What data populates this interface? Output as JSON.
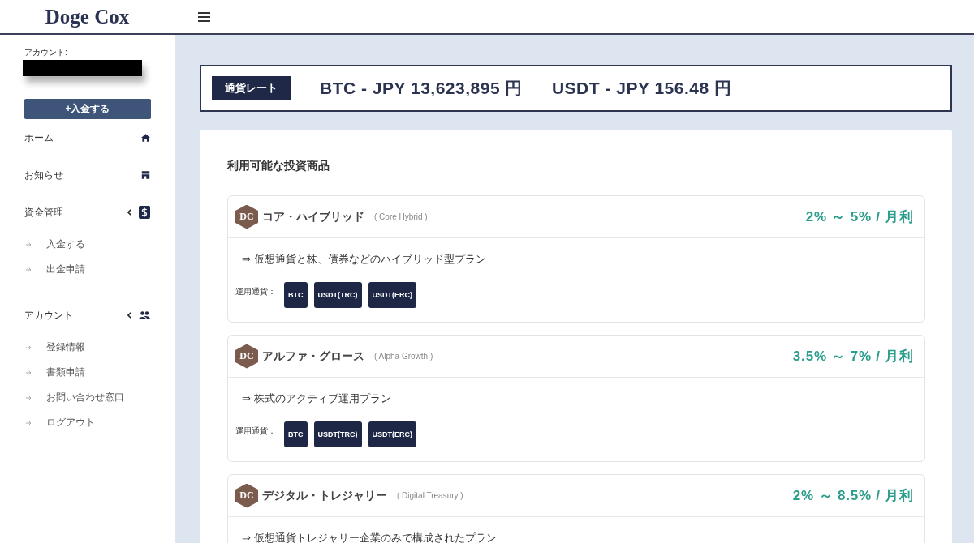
{
  "header": {
    "brand": "Doge Cox"
  },
  "sidebar": {
    "account_label": "アカウント:",
    "deposit_button": "+入金する",
    "nav": [
      {
        "kind": "link",
        "label": "ホーム"
      },
      {
        "kind": "link",
        "label": "お知らせ"
      },
      {
        "kind": "group",
        "label": "資金管理",
        "expanded": true,
        "children": [
          {
            "label": "入金する"
          },
          {
            "label": "出金申請"
          }
        ]
      },
      {
        "kind": "group",
        "label": "アカウント",
        "expanded": true,
        "children": [
          {
            "label": "登録情報"
          },
          {
            "label": "書類申請"
          },
          {
            "label": "お問い合わせ窓口"
          },
          {
            "label": "ログアウト"
          }
        ]
      }
    ]
  },
  "rates": {
    "badge": "通貨レート",
    "items": [
      "BTC - JPY 13,623,895 円",
      "USDT - JPY 156.48 円"
    ]
  },
  "products": {
    "title": "利用可能な投資商品",
    "items": [
      {
        "logo": "DC",
        "name": "コア・ハイブリッド",
        "name_en": "( Core Hybrid )",
        "rate": "2% ～ 5% / 月利",
        "description": "⇒ 仮想通貨と株、債券などのハイブリッド型プラン",
        "currency_label": "運用通貨：",
        "currencies": [
          "BTC",
          "USDT(TRC)",
          "USDT(ERC)"
        ]
      },
      {
        "logo": "DC",
        "name": "アルファ・グロース",
        "name_en": "( Alpha Growth )",
        "rate": "3.5% ～ 7% / 月利",
        "description": "⇒ 株式のアクティブ運用プラン",
        "currency_label": "運用通貨：",
        "currencies": [
          "BTC",
          "USDT(TRC)",
          "USDT(ERC)"
        ]
      },
      {
        "logo": "DC",
        "name": "デジタル・トレジャリー",
        "name_en": "( Digital Treasury )",
        "rate": "2% ～ 8.5% / 月利",
        "description": "⇒ 仮想通貨トレジャリー企業のみで構成されたプラン"
      }
    ]
  }
}
